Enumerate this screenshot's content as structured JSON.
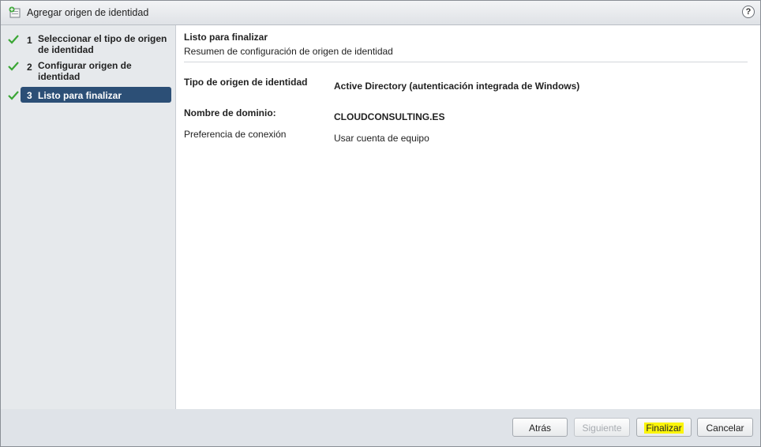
{
  "window": {
    "title": "Agregar origen de identidad",
    "help": "?"
  },
  "steps": [
    {
      "number": "1",
      "label": "Seleccionar el tipo de origen de identidad",
      "completed": true,
      "active": false
    },
    {
      "number": "2",
      "label": "Configurar origen de identidad",
      "completed": true,
      "active": false
    },
    {
      "number": "3",
      "label": "Listo para finalizar",
      "completed": true,
      "active": true
    }
  ],
  "content": {
    "heading": "Listo para finalizar",
    "subheading": "Resumen de configuración de origen de identidad",
    "fields": [
      {
        "label": "Tipo de origen de identidad",
        "value": "Active Directory (autenticación integrada de Windows)"
      },
      {
        "label": "Nombre de dominio:",
        "value": "CLOUDCONSULTING.ES"
      },
      {
        "label": "Preferencia de conexión",
        "value": "Usar cuenta de equipo"
      }
    ]
  },
  "buttons": {
    "back": "Atrás",
    "next": "Siguiente",
    "finish": "Finalizar",
    "cancel": "Cancelar"
  },
  "colors": {
    "active_step": "#2c4f76",
    "check": "#3aa635",
    "highlight": "#fbf50a"
  }
}
